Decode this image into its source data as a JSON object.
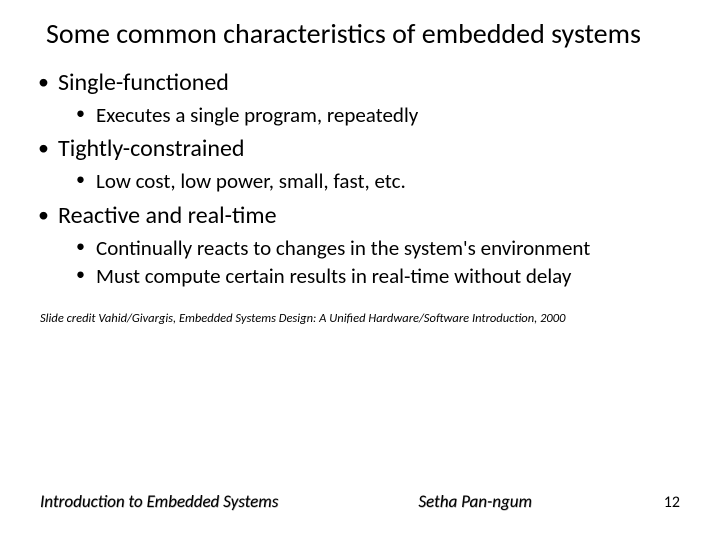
{
  "title": "Some common characteristics of embedded systems",
  "bullets": [
    {
      "text": "Single-functioned",
      "sub": [
        "Executes a single program, repeatedly"
      ]
    },
    {
      "text": "Tightly-constrained",
      "sub": [
        "Low cost, low power, small, fast, etc."
      ]
    },
    {
      "text": "Reactive and real-time",
      "sub": [
        "Continually reacts to changes in the system's environment",
        "Must compute certain results in real-time without delay"
      ]
    }
  ],
  "credit": "Slide credit Vahid/Givargis, Embedded Systems Design: A Unified Hardware/Software Introduction, 2000",
  "footer": {
    "left": "Introduction to Embedded Systems",
    "center": "Setha Pan-ngum",
    "right": "12"
  }
}
